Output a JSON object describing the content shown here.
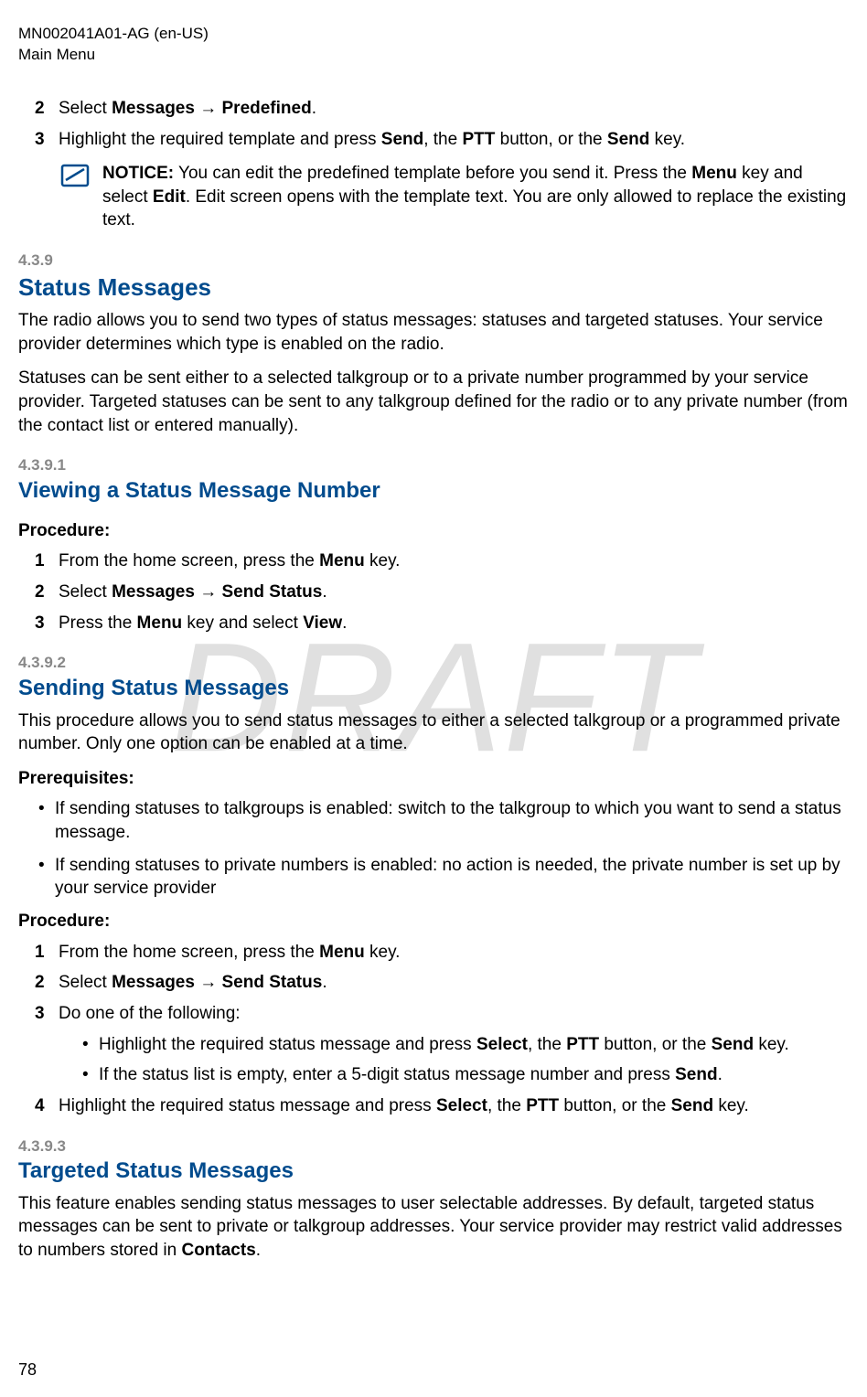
{
  "header": {
    "doc_id": "MN002041A01-AG (en-US)",
    "section": "Main Menu"
  },
  "watermark": "DRAFT",
  "step2": {
    "num": "2",
    "pre": "Select ",
    "b1": "Messages",
    "arrow": " → ",
    "b2": "Predefined",
    "post": "."
  },
  "step3": {
    "num": "3",
    "t1": "Highlight the required template and press ",
    "b1": "Send",
    "t2": ", the ",
    "b2": "PTT",
    "t3": " button, or the ",
    "b3": "Send",
    "t4": " key."
  },
  "notice": {
    "label": "NOTICE:",
    "t1": " You can edit the predefined template before you send it. Press the ",
    "b1": "Menu",
    "t2": " key and select ",
    "b2": "Edit",
    "t3": ". Edit screen opens with the template text. You are only allowed to replace the existing text."
  },
  "s439": {
    "num": "4.3.9",
    "title": "Status Messages",
    "p1": "The radio allows you to send two types of status messages: statuses and targeted statuses. Your service provider determines which type is enabled on the radio.",
    "p2": "Statuses can be sent either to a selected talkgroup or to a private number programmed by your service provider. Targeted statuses can be sent to any talkgroup defined for the radio or to any private number (from the contact list or entered manually)."
  },
  "s4391": {
    "num": "4.3.9.1",
    "title": "Viewing a Status Message Number",
    "proc": "Procedure:",
    "step1": {
      "num": "1",
      "t1": "From the home screen, press the ",
      "b1": "Menu",
      "t2": " key."
    },
    "step2": {
      "num": "2",
      "t1": "Select ",
      "b1": "Messages",
      "arrow": " → ",
      "b2": "Send Status",
      "t2": "."
    },
    "step3": {
      "num": "3",
      "t1": "Press the ",
      "b1": "Menu",
      "t2": " key and select ",
      "b2": "View",
      "t3": "."
    }
  },
  "s4392": {
    "num": "4.3.9.2",
    "title": "Sending Status Messages",
    "p1": "This procedure allows you to send status messages to either a selected talkgroup or a programmed private number. Only one option can be enabled at a time.",
    "prereq": "Prerequisites:",
    "pr1": "If sending statuses to talkgroups is enabled: switch to the talkgroup to which you want to send a status message.",
    "pr2": "If sending statuses to private numbers is enabled: no action is needed, the private number is set up by your service provider",
    "proc": "Procedure:",
    "step1": {
      "num": "1",
      "t1": "From the home screen, press the ",
      "b1": "Menu",
      "t2": " key."
    },
    "step2": {
      "num": "2",
      "t1": "Select ",
      "b1": "Messages",
      "arrow": " → ",
      "b2": "Send Status",
      "t2": "."
    },
    "step3": {
      "num": "3",
      "t1": "Do one of the following:"
    },
    "sub1": {
      "t1": "Highlight the required status message and press ",
      "b1": "Select",
      "t2": ", the ",
      "b2": "PTT",
      "t3": " button, or the ",
      "b3": "Send",
      "t4": " key."
    },
    "sub2": {
      "t1": "If the status list is empty, enter a 5-digit status message number and press ",
      "b1": "Send",
      "t2": "."
    },
    "step4": {
      "num": "4",
      "t1": "Highlight the required status message and press ",
      "b1": "Select",
      "t2": ", the ",
      "b2": "PTT",
      "t3": " button, or the ",
      "b3": "Send",
      "t4": " key."
    }
  },
  "s4393": {
    "num": "4.3.9.3",
    "title": "Targeted Status Messages",
    "p1a": "This feature enables sending status messages to user selectable addresses. By default, targeted status messages can be sent to private or talkgroup addresses. Your service provider may restrict valid addresses to numbers stored in ",
    "b1": "Contacts",
    "p1b": "."
  },
  "page": "78"
}
